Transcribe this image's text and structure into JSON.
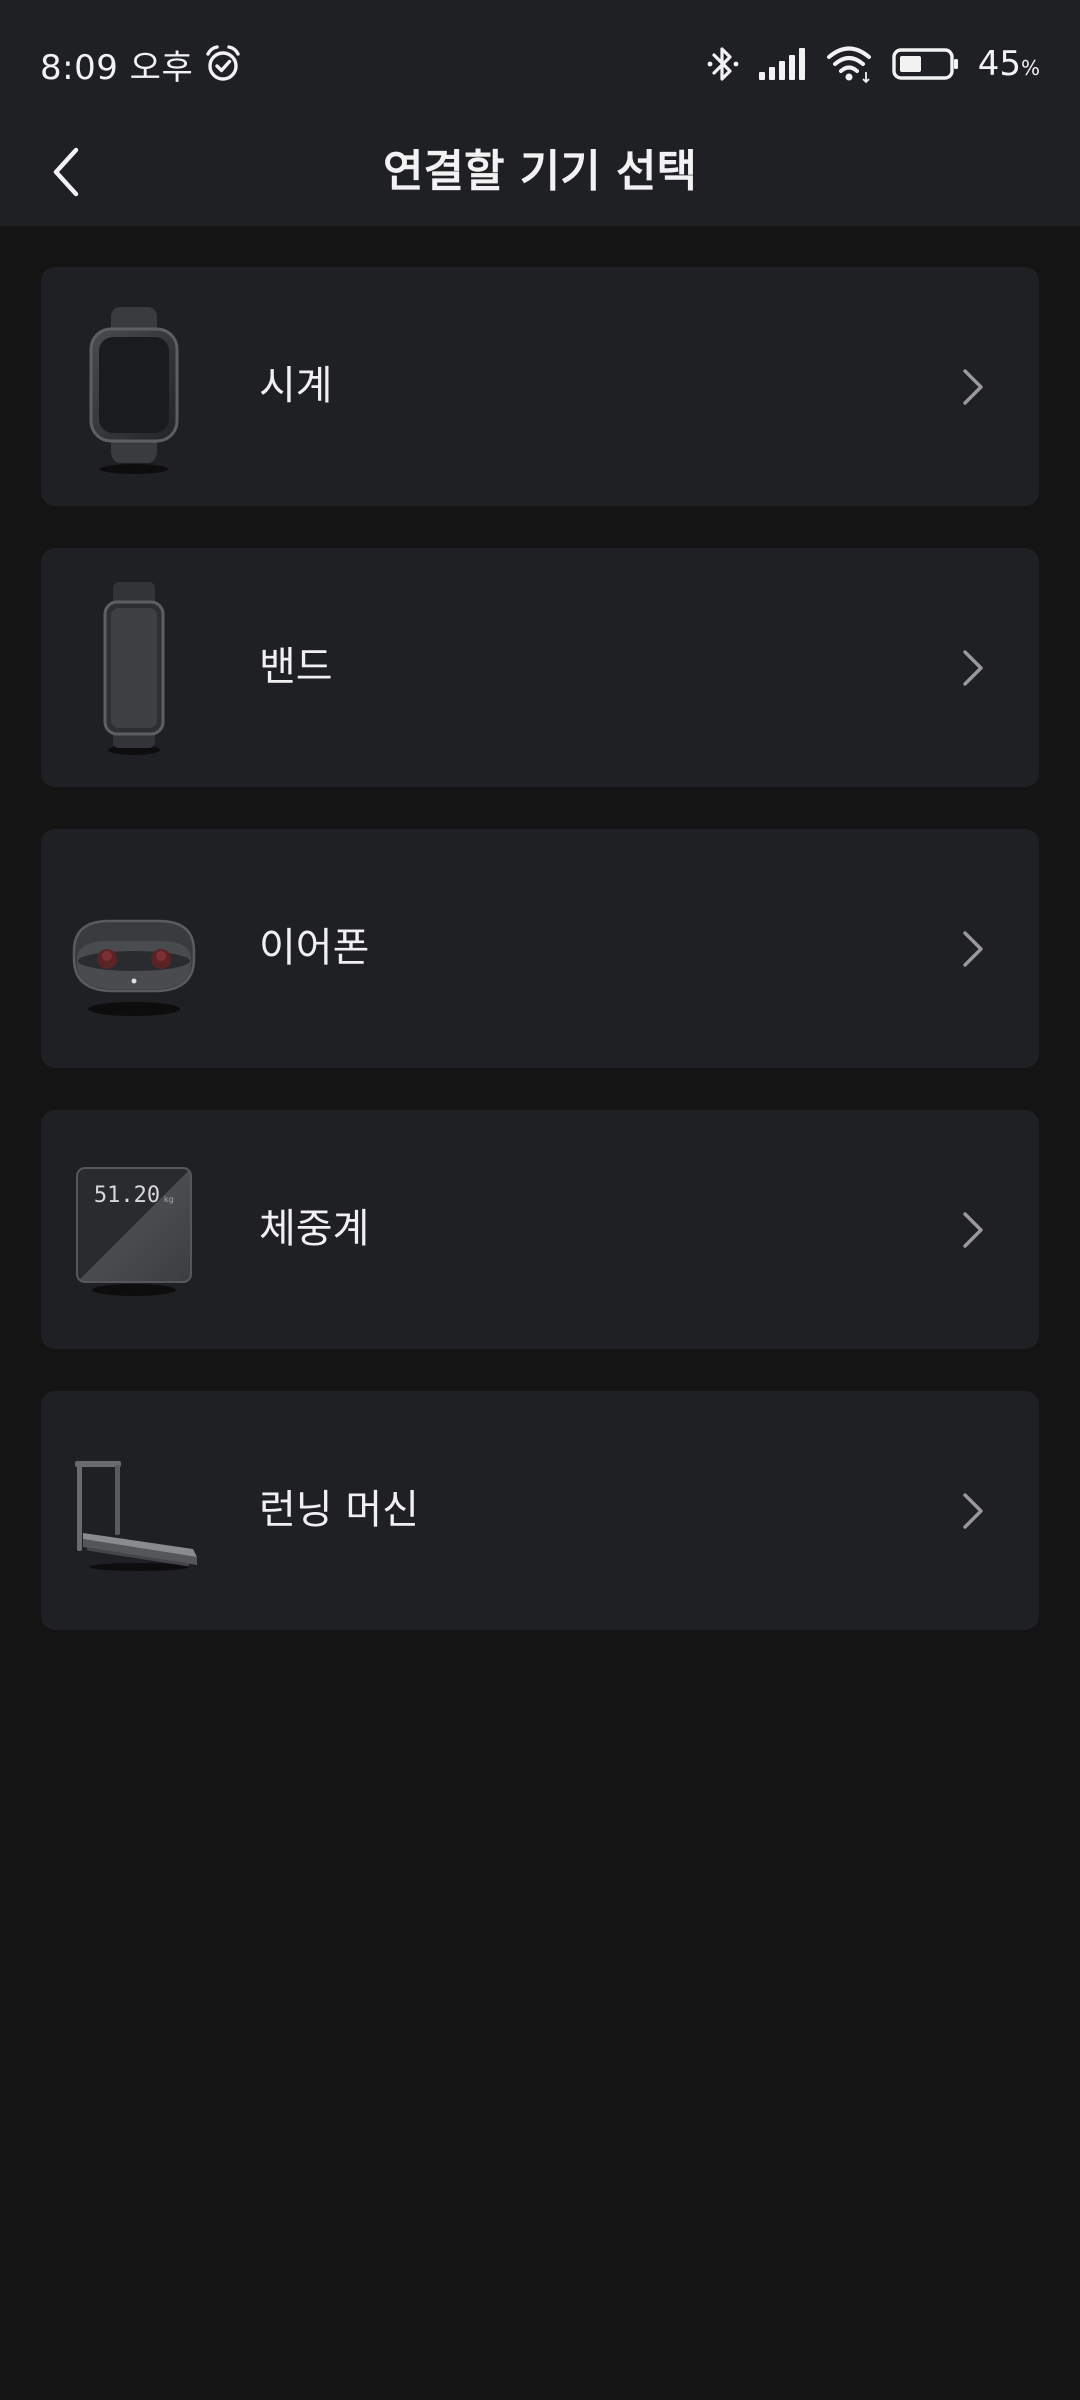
{
  "status_bar": {
    "time": "8:09 오후",
    "battery_percent": "45",
    "battery_unit": "%",
    "battery_level": 0.45,
    "icons": [
      "alarm-icon",
      "bluetooth-icon",
      "signal-icon",
      "wifi-icon",
      "battery-icon"
    ]
  },
  "header": {
    "title": "연결할 기기 선택",
    "back_icon": "chevron-left-icon"
  },
  "devices": [
    {
      "label": "시계",
      "icon": "watch-icon"
    },
    {
      "label": "밴드",
      "icon": "band-icon"
    },
    {
      "label": "이어폰",
      "icon": "earbuds-icon"
    },
    {
      "label": "체중계",
      "icon": "scale-icon",
      "display": "51.20",
      "display_unit": "kg"
    },
    {
      "label": "런닝 머신",
      "icon": "treadmill-icon"
    }
  ],
  "colors": {
    "background": "#141414",
    "surface": "#1f2023",
    "text": "#f0f0f0",
    "chevron": "#9a9a9a"
  }
}
